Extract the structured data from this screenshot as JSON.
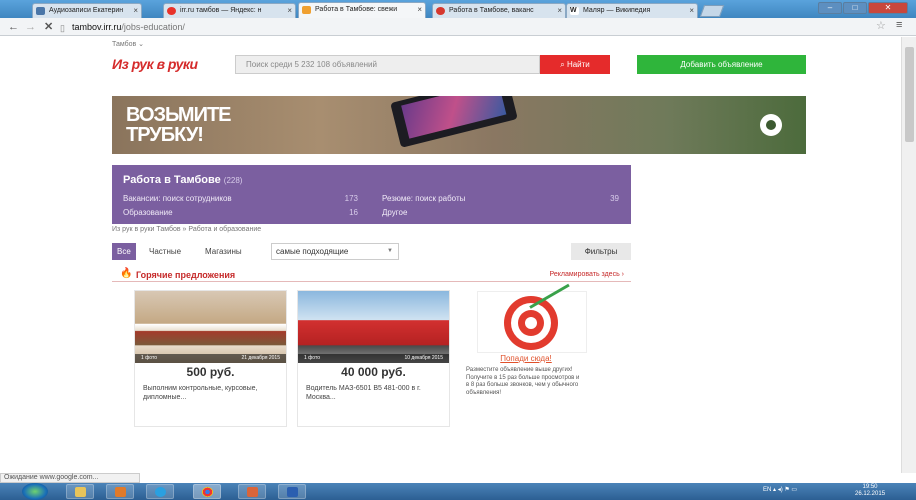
{
  "browser": {
    "tabs": [
      {
        "label": "Аудиозаписи Екатерин",
        "color": "#4a76a8"
      },
      {
        "label": "irr.ru тамбов — Яндекс: н",
        "color": "#e8332b"
      },
      {
        "label": "Работа в Тамбове: свежи",
        "color": "#f0a030"
      },
      {
        "label": "Работа в Тамбове, ваканс",
        "color": "#d6382e"
      },
      {
        "label": "Маляр — Википедия",
        "color": "#555555"
      }
    ],
    "url_host": "tambov.irr.ru",
    "url_path": "/jobs-education/"
  },
  "site": {
    "city": "Тамбов",
    "logo": "Из рук в руки",
    "search_placeholder": "Поиск среди 5 232 108 объявлений",
    "find_button": "Найти",
    "add_button": "Добавить объявление",
    "brand_color": "#d52b2b"
  },
  "banner": {
    "text_line1": "ВОЗЬМИТЕ",
    "text_line2": "ТРУБКУ!"
  },
  "category": {
    "title": "Работа в Тамбове",
    "count": "(228)",
    "items": [
      {
        "label": "Вакансии: поиск сотрудников",
        "count": "173"
      },
      {
        "label": "Резюме: поиск работы",
        "count": "39"
      },
      {
        "label": "Образование",
        "count": "16"
      },
      {
        "label": "Другое",
        "count": ""
      }
    ],
    "color": "#7b5fa0"
  },
  "breadcrumb": "Из рук в руки Тамбов  »  Работа и образование",
  "filters": {
    "tabs": [
      "Все",
      "Частные",
      "Магазины"
    ],
    "sort": "самые подходящие",
    "button": "Фильтры"
  },
  "hot": {
    "title": "Горячие предложения",
    "advertise": "Рекламировать здесь ›"
  },
  "cards": [
    {
      "photos": "1 фото",
      "date": "21 декабря 2015",
      "price": "500 руб.",
      "desc": "Выполним контрольные, курсовые, дипломные..."
    },
    {
      "photos": "1 фото",
      "date": "10 декабря 2015",
      "price": "40 000 руб.",
      "desc": "Водитель МАЗ-6501 В5 481-000 в г. Москва..."
    }
  ],
  "promo": {
    "link": "Попади сюда!",
    "text": "Разместите объявление выше других! Получите в 15 раз больше просмотров и в 8 раз больше звонков, чем у обычного объявления!"
  },
  "status_text": "Ожидание www.google.com...",
  "tray": {
    "lang": "EN",
    "time": "19:50",
    "date": "26.12.2015"
  }
}
